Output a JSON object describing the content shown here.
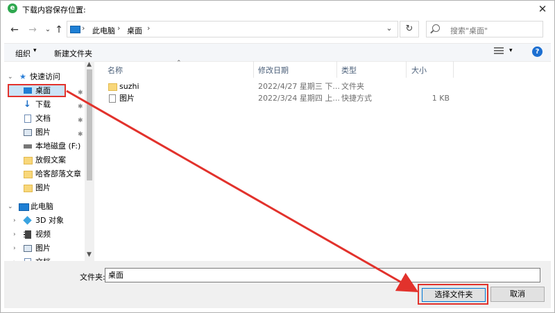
{
  "window": {
    "title": "下载内容保存位置:",
    "close_glyph": "✕",
    "app_icon_letter": "e"
  },
  "navigation": {
    "back": "←",
    "forward": "→",
    "recent": "⌄",
    "up": "↑",
    "breadcrumb": [
      "此电脑",
      "桌面"
    ],
    "separator": "›",
    "address_dropdown": "⌄",
    "refresh": "↻",
    "search_placeholder": "搜索\"桌面\""
  },
  "toolbar": {
    "organize": "组织",
    "dropdown_glyph": "▾",
    "new_folder": "新建文件夹",
    "help": "?"
  },
  "nav_pane": {
    "quick_access": "快速访问",
    "items": [
      {
        "label": "桌面",
        "icon": "desktop-icon",
        "pinned": true,
        "selected": true
      },
      {
        "label": "下载",
        "icon": "download-icon",
        "pinned": true
      },
      {
        "label": "文档",
        "icon": "document-icon",
        "pinned": true
      },
      {
        "label": "图片",
        "icon": "picture-icon",
        "pinned": true
      },
      {
        "label": "本地磁盘 (F:)",
        "icon": "drive-icon",
        "pinned": false
      },
      {
        "label": "放假文案",
        "icon": "folder-icon",
        "pinned": false
      },
      {
        "label": "哈客部落文章",
        "icon": "folder-icon",
        "pinned": false
      },
      {
        "label": "图片",
        "icon": "folder-icon",
        "pinned": false
      }
    ],
    "this_pc": "此电脑",
    "pc_items": [
      {
        "label": "3D 对象",
        "icon": "3d-objects-icon"
      },
      {
        "label": "视频",
        "icon": "video-icon"
      },
      {
        "label": "图片",
        "icon": "picture-icon"
      },
      {
        "label": "文档",
        "icon": "document-icon"
      }
    ],
    "pin_glyph": "📌"
  },
  "file_list": {
    "columns": [
      "名称",
      "修改日期",
      "类型",
      "大小"
    ],
    "rows": [
      {
        "name": "suzhi",
        "date": "2022/4/27 星期三 下...",
        "type": "文件夹",
        "size": "",
        "icon": "folder-icon"
      },
      {
        "name": "图片",
        "date": "2022/3/24 星期四 上...",
        "type": "快捷方式",
        "size": "1 KB",
        "icon": "shortcut-icon"
      }
    ]
  },
  "bottom": {
    "folder_label": "文件夹:",
    "folder_value": "桌面",
    "select_button": "选择文件夹",
    "cancel_button": "取消"
  },
  "colors": {
    "annotation": "#e2322c",
    "selection": "#cce4f7",
    "accent": "#1c6fd1"
  }
}
